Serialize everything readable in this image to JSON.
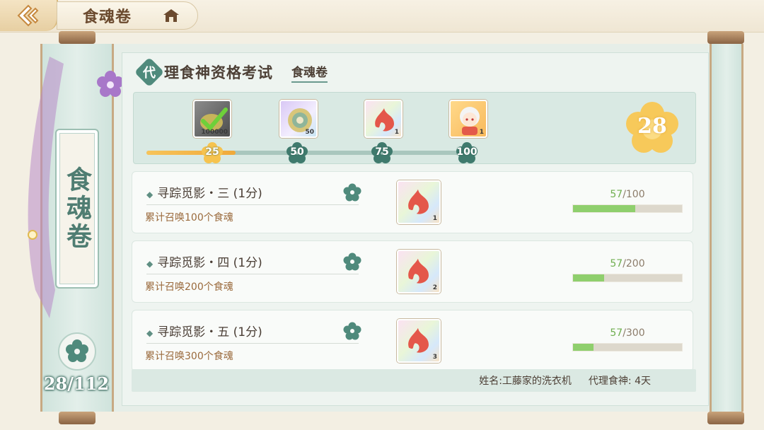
{
  "header": {
    "title": "食魂卷"
  },
  "left_panel": {
    "category_label": "食魂卷",
    "count": "28/112"
  },
  "exam": {
    "badge": "代",
    "title": "理食神资格考试",
    "subtitle": "食魂卷"
  },
  "milestones": {
    "rewards": [
      {
        "qty": "100000",
        "style": "gray",
        "icon": "checkmark-icon",
        "claimed": true
      },
      {
        "qty": "50",
        "style": "purple",
        "icon": "coin-icon"
      },
      {
        "qty": "1",
        "style": "rainbow",
        "icon": "flame-icon"
      },
      {
        "qty": "1",
        "style": "gold",
        "icon": "chibi-character-icon"
      }
    ],
    "nodes": [
      "25",
      "50",
      "75",
      "100"
    ],
    "current_score": "28",
    "progress_fraction": 0.28
  },
  "tasks": [
    {
      "name": "寻踪觅影・三 (1分)",
      "desc": "累计召唤100个食魂",
      "reward_qty": "1",
      "current": "57",
      "target": "/100",
      "progress": 0.57
    },
    {
      "name": "寻踪觅影・四 (1分)",
      "desc": "累计召唤200个食魂",
      "reward_qty": "2",
      "current": "57",
      "target": "/200",
      "progress": 0.285
    },
    {
      "name": "寻踪觅影・五 (1分)",
      "desc": "累计召唤300个食魂",
      "reward_qty": "3",
      "current": "57",
      "target": "/300",
      "progress": 0.19
    }
  ],
  "footer": {
    "name": "姓名:工藤家的洗衣机",
    "role": "代理食神: 4天"
  },
  "colors": {
    "accent_green": "#4f8a7c",
    "progress_orange": "#f0a93a",
    "bar_green": "#8fcf6d",
    "score_gold": "#f7c95a"
  }
}
